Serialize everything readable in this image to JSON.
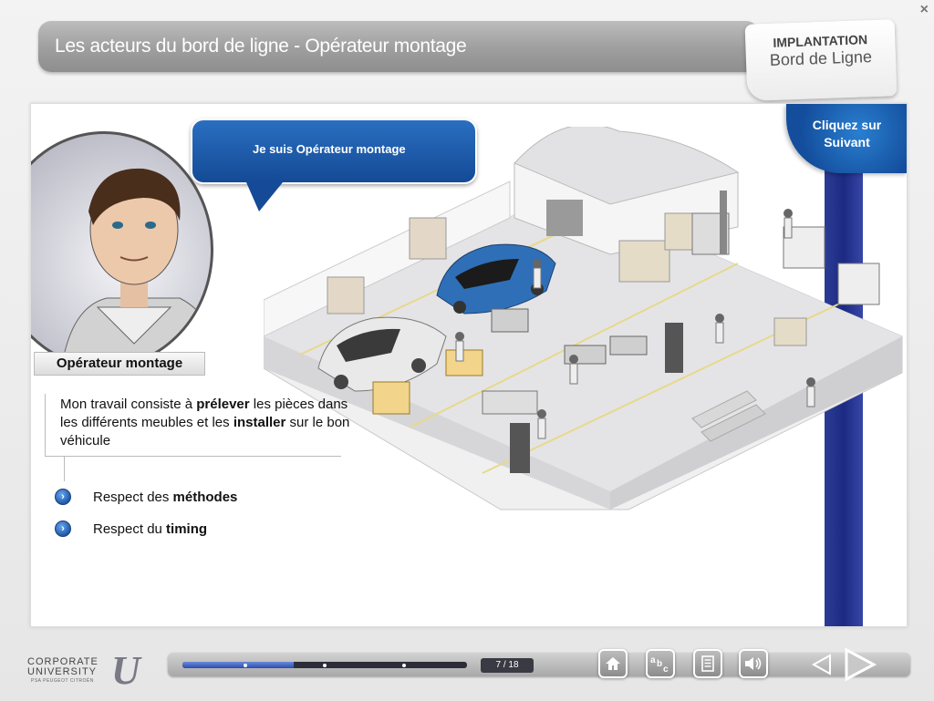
{
  "window": {
    "close_symbol": "×"
  },
  "header": {
    "title": "Les acteurs du bord de ligne - Opérateur montage",
    "tab_line1": "IMPLANTATION",
    "tab_line2": "Bord de Ligne"
  },
  "next_hint": {
    "line1": "Cliquez sur",
    "line2": "Suivant"
  },
  "speech_bubble": "Je suis Opérateur montage",
  "role_label": "Opérateur montage",
  "description": {
    "part1": "Mon travail consiste à ",
    "bold1": "prélever",
    "part2": " les pièces dans les différents meubles et les ",
    "bold2": "installer",
    "part3": " sur le bon véhicule"
  },
  "bullets": [
    {
      "text": "Respect des ",
      "bold": "méthodes"
    },
    {
      "text": "Respect du ",
      "bold": "timing"
    }
  ],
  "footer": {
    "logo_line1": "CORPORATE",
    "logo_line2": "UNIVERSITY",
    "logo_line3": "PSA PEUGEOT CITROËN",
    "page_count": "7 / 18",
    "progress": 0.39,
    "buttons": [
      "home-icon",
      "glossary-icon",
      "document-icon",
      "sound-icon"
    ]
  },
  "colors": {
    "accent_blue": "#1c4f9f",
    "strip_blue": "#1c2a82",
    "header_grey": "#9e9e9e"
  }
}
